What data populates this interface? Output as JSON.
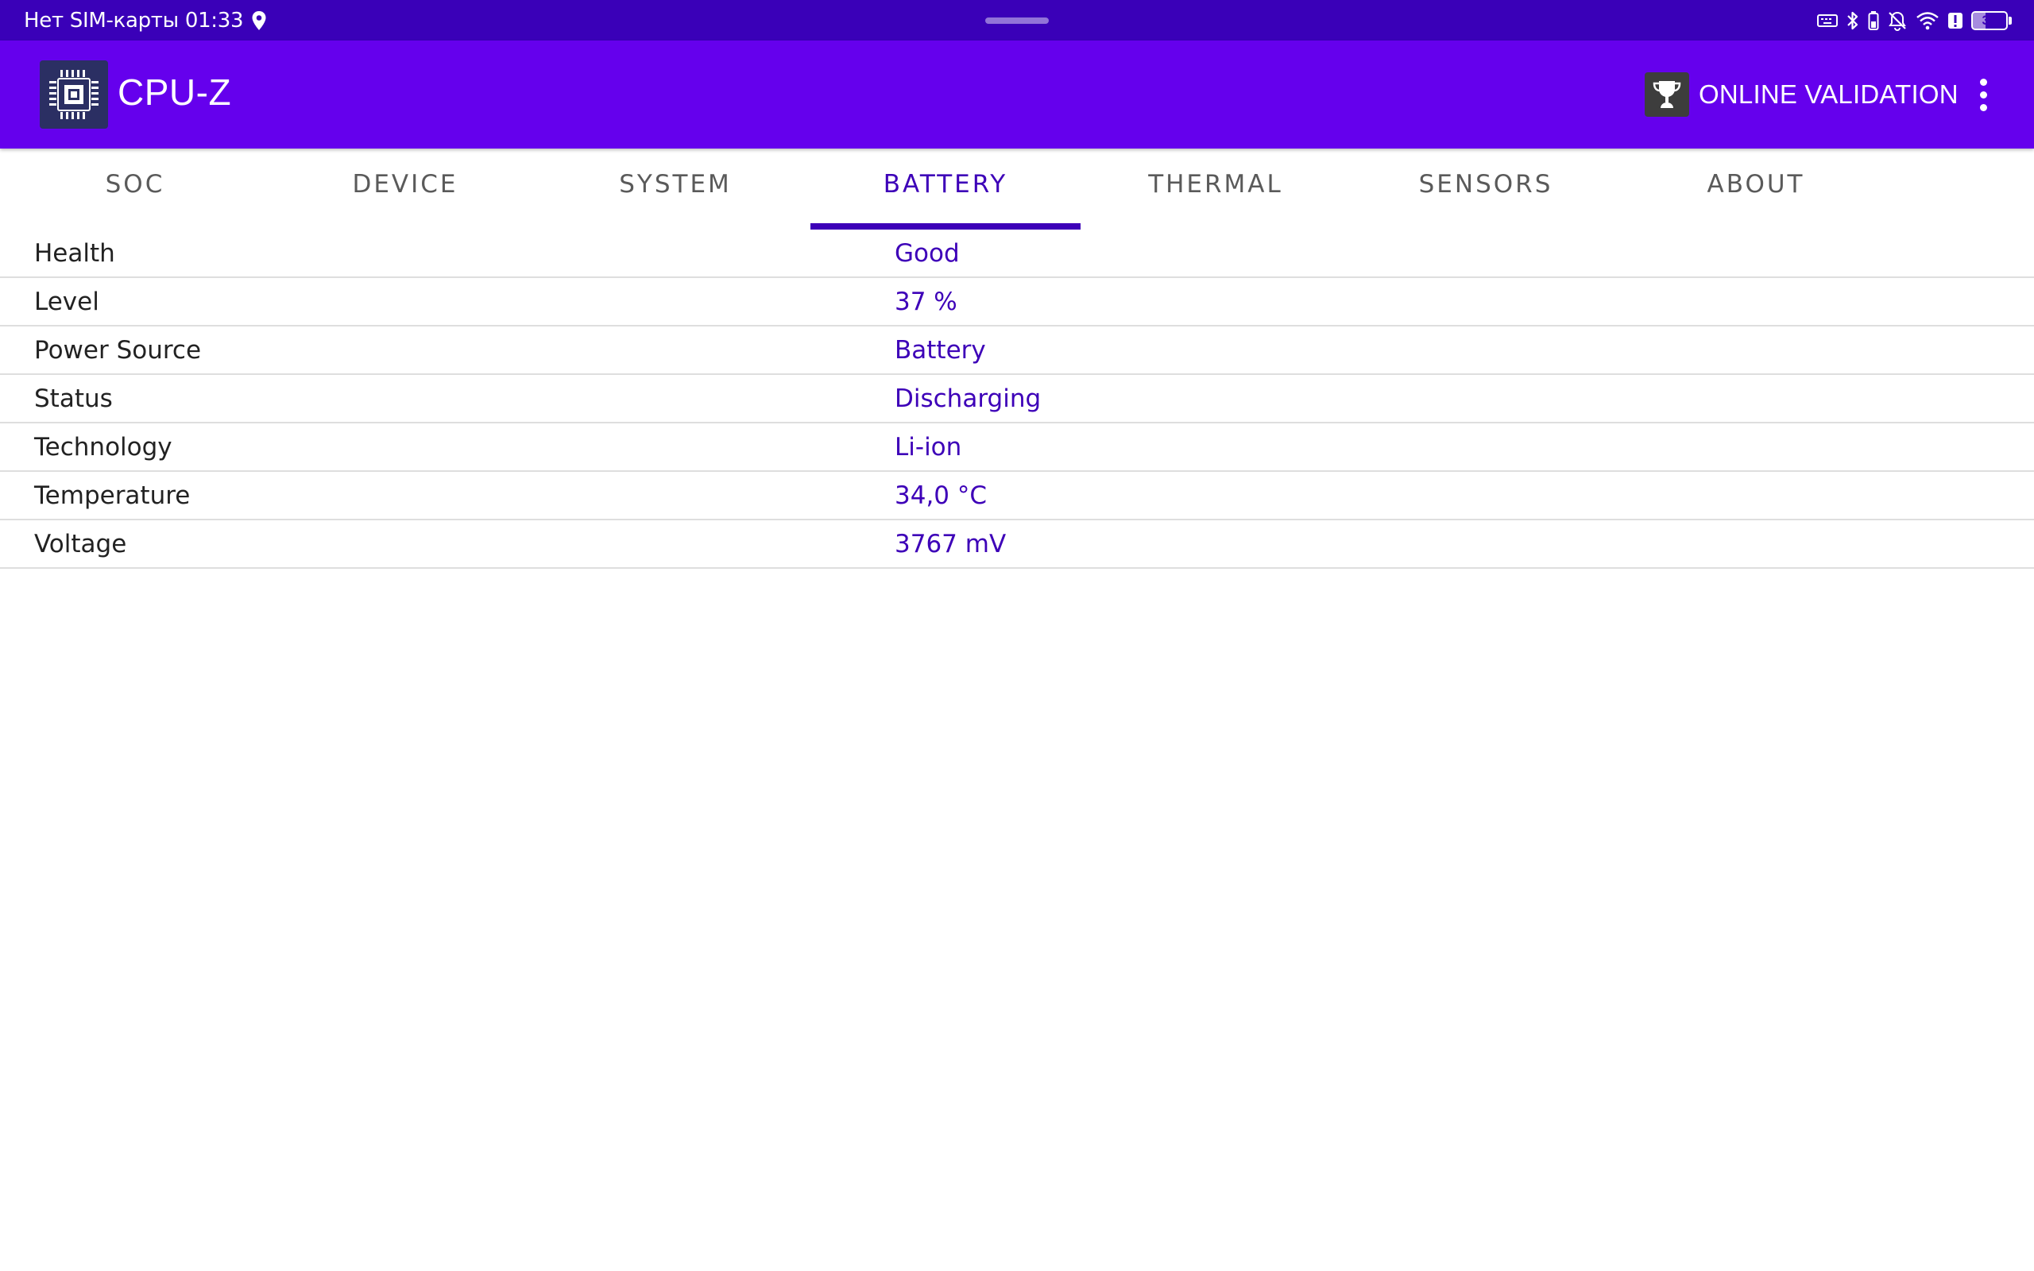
{
  "status_bar": {
    "carrier_time": "Нет SIM-карты 01:33",
    "battery_level": "37",
    "battery_fraction": 0.37
  },
  "app_bar": {
    "title": "CPU-Z",
    "validation_label": "ONLINE VALIDATION"
  },
  "tabs": [
    {
      "label": "SOC",
      "active": false
    },
    {
      "label": "DEVICE",
      "active": false
    },
    {
      "label": "SYSTEM",
      "active": false
    },
    {
      "label": "BATTERY",
      "active": true
    },
    {
      "label": "THERMAL",
      "active": false
    },
    {
      "label": "SENSORS",
      "active": false
    },
    {
      "label": "ABOUT",
      "active": false
    }
  ],
  "battery_info": [
    {
      "label": "Health",
      "value": "Good"
    },
    {
      "label": "Level",
      "value": "37 %"
    },
    {
      "label": "Power Source",
      "value": "Battery"
    },
    {
      "label": "Status",
      "value": "Discharging"
    },
    {
      "label": "Technology",
      "value": "Li-ion"
    },
    {
      "label": "Temperature",
      "value": "34,0 °C"
    },
    {
      "label": "Voltage",
      "value": "3767 mV"
    }
  ],
  "colors": {
    "status_bar": "#3a00b8",
    "app_bar": "#6500ed",
    "accent": "#3d00b8",
    "tab_inactive": "#5a5a5a"
  }
}
